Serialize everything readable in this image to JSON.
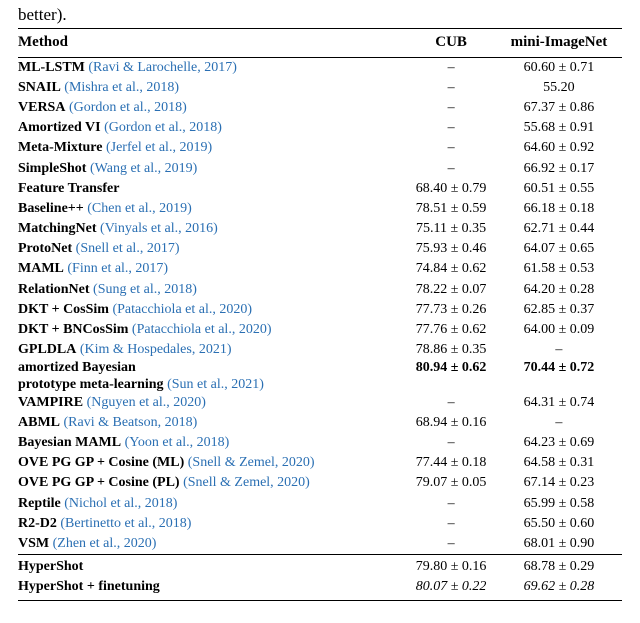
{
  "caption_fragment": "better).",
  "header": {
    "method": "Method",
    "cub": "CUB",
    "mini": "mini-ImageNet"
  },
  "chart_data": {
    "type": "table",
    "columns": [
      "Method",
      "CUB",
      "mini-ImageNet"
    ],
    "rows": [
      {
        "name": "ML-LSTM",
        "cite": "Ravi & Larochelle, 2017",
        "cub": "–",
        "mini": "60.60 ± 0.71"
      },
      {
        "name": "SNAIL",
        "cite": "Mishra et al., 2018",
        "cub": "–",
        "mini": "55.20"
      },
      {
        "name": "VERSA",
        "cite": "Gordon et al., 2018",
        "cub": "–",
        "mini": "67.37 ± 0.86"
      },
      {
        "name": "Amortized VI",
        "cite": "Gordon et al., 2018",
        "cub": "–",
        "mini": "55.68 ± 0.91"
      },
      {
        "name": "Meta-Mixture",
        "cite": "Jerfel et al., 2019",
        "cub": "–",
        "mini": "64.60 ± 0.92"
      },
      {
        "name": "SimpleShot",
        "cite": "Wang et al., 2019",
        "cub": "–",
        "mini": "66.92 ± 0.17"
      },
      {
        "name": "Feature Transfer",
        "cite": "",
        "cub": "68.40 ± 0.79",
        "mini": "60.51 ± 0.55"
      },
      {
        "name": "Baseline++",
        "cite": "Chen et al., 2019",
        "cub": "78.51 ± 0.59",
        "mini": "66.18 ± 0.18"
      },
      {
        "name": "MatchingNet",
        "cite": "Vinyals et al., 2016",
        "cub": "75.11 ± 0.35",
        "mini": "62.71 ± 0.44"
      },
      {
        "name": "ProtoNet",
        "cite": "Snell et al., 2017",
        "cub": "75.93 ± 0.46",
        "mini": "64.07 ± 0.65"
      },
      {
        "name": "MAML",
        "cite": "Finn et al., 2017",
        "cub": "74.84 ± 0.62",
        "mini": "61.58 ± 0.53"
      },
      {
        "name": "RelationNet",
        "cite": "Sung et al., 2018",
        "cub": "78.22 ± 0.07",
        "mini": "64.20 ± 0.28"
      },
      {
        "name": "DKT + CosSim",
        "cite": "Patacchiola et al., 2020",
        "cub": "77.73 ± 0.26",
        "mini": "62.85 ± 0.37"
      },
      {
        "name": "DKT + BNCosSim",
        "cite": "Patacchiola et al., 2020",
        "cub": "77.76 ± 0.62",
        "mini": "64.00 ± 0.09"
      },
      {
        "name": "GPLDLA",
        "cite": "Kim & Hospedales, 2021",
        "cub": "78.86 ± 0.35",
        "mini": "–"
      },
      {
        "name": "amortized Bayesian",
        "name2": "prototype meta-learning",
        "cite": "Sun et al., 2021",
        "cub": "80.94 ± 0.62",
        "mini": "70.44 ± 0.72",
        "bold": true,
        "multiline": true
      },
      {
        "name": "VAMPIRE",
        "cite": "Nguyen et al., 2020",
        "cub": "–",
        "mini": "64.31 ± 0.74"
      },
      {
        "name": "ABML",
        "cite": "Ravi & Beatson, 2018",
        "cub": "68.94 ± 0.16",
        "mini": "–"
      },
      {
        "name": "Bayesian MAML",
        "cite": "Yoon et al., 2018",
        "cub": "–",
        "mini": "64.23 ± 0.69"
      },
      {
        "name": "OVE PG GP + Cosine (ML)",
        "cite": "Snell & Zemel, 2020",
        "cub": "77.44 ± 0.18",
        "mini": "64.58 ± 0.31"
      },
      {
        "name": "OVE PG GP + Cosine (PL)",
        "cite": "Snell & Zemel, 2020",
        "cub": "79.07 ± 0.05",
        "mini": "67.14 ± 0.23"
      },
      {
        "name": "Reptile",
        "cite": "Nichol et al., 2018",
        "cub": "–",
        "mini": "65.99 ± 0.58"
      },
      {
        "name": "R2-D2",
        "cite": "Bertinetto et al., 2018",
        "cub": "–",
        "mini": "65.50 ± 0.60"
      },
      {
        "name": "VSM",
        "cite": "Zhen et al., 2020",
        "cub": "–",
        "mini": "68.01 ± 0.90"
      },
      {
        "name": "HyperShot",
        "cite": "",
        "cub": "79.80 ± 0.16",
        "mini": "68.78 ± 0.29",
        "sep": true
      },
      {
        "name": "HyperShot + finetuning",
        "cite": "",
        "cub": "80.07 ± 0.22",
        "mini": "69.62 ± 0.28",
        "italic": true
      }
    ]
  }
}
